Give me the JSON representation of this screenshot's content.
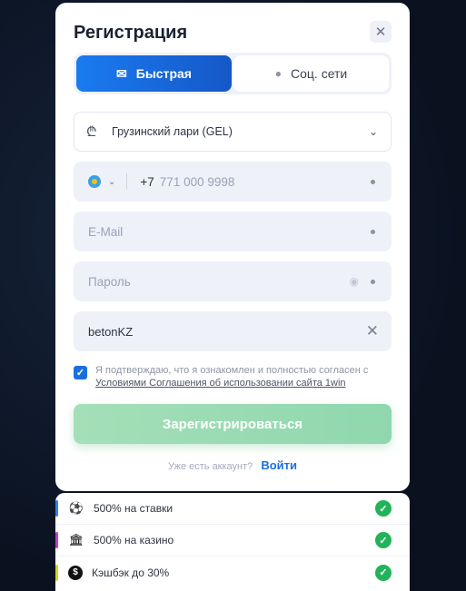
{
  "modal": {
    "title": "Регистрация",
    "close_glyph": "✕"
  },
  "tabs": [
    {
      "label": "Быстрая",
      "icon": "envelope-icon",
      "glyph": "✉"
    },
    {
      "label": "Соц. сети",
      "icon": "chat-bubbles-icon",
      "glyph": "●"
    }
  ],
  "currency": {
    "value": "Грузинский лари (GEL)",
    "icon": "lari-currency-icon",
    "glyph": "₾"
  },
  "phone": {
    "code": "+7",
    "placeholder": "771 000 9998",
    "flag": "kazakhstan-flag-icon"
  },
  "email": {
    "placeholder": "E-Mail"
  },
  "password": {
    "placeholder": "Пароль"
  },
  "promo": {
    "value": "betonKZ"
  },
  "agreement": {
    "text": "Я подтверждаю, что я ознакомлен и полностью согласен с",
    "link": "Условиями Соглашения об использовании сайта 1win"
  },
  "register_button": "Зарегистрироваться",
  "login": {
    "prompt": "Уже есть аккаунт?",
    "link": "Войти"
  },
  "bonuses": [
    {
      "label": "500% на ставки",
      "icon": "soccer-ball-icon",
      "glyph": "⚽",
      "accent": "#2f7ff0"
    },
    {
      "label": "500% на казино",
      "icon": "casino-building-icon",
      "glyph": "🏛",
      "accent": "#c13ad8"
    },
    {
      "label": "Кэшбэк до 30%",
      "icon": "cashback-coin-icon",
      "glyph": "$",
      "accent": "#c7de1c"
    }
  ],
  "colors": {
    "accent_blue": "#1a6fe0",
    "register_green": "#a4dfb8",
    "check_green": "#22b35a"
  }
}
